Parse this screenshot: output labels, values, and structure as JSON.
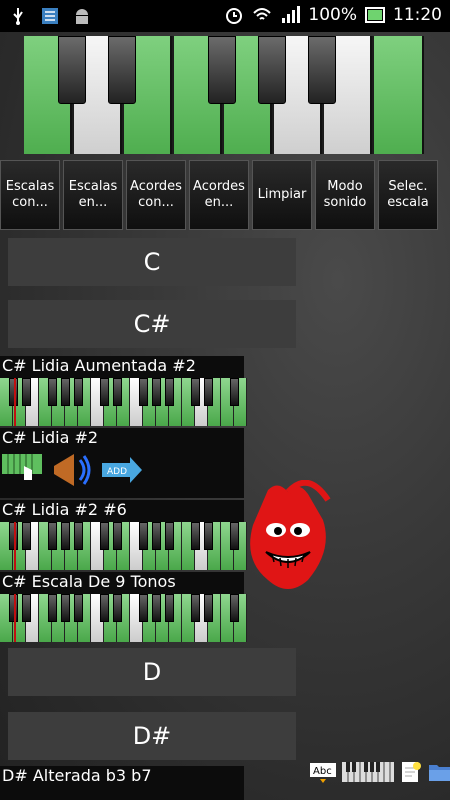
{
  "status": {
    "battery": "100%",
    "time": "11:20"
  },
  "buttons": [
    {
      "label": "Escalas con..."
    },
    {
      "label": "Escalas en..."
    },
    {
      "label": "Acordes con..."
    },
    {
      "label": "Acordes en..."
    },
    {
      "label": "Limpiar"
    },
    {
      "label": "Modo sonido"
    },
    {
      "label": "Selec. escala"
    }
  ],
  "notes": [
    "C",
    "C#",
    "D",
    "D#"
  ],
  "scales": [
    {
      "title": "C# Lidia Aumentada #2"
    },
    {
      "title": "C# Lidia #2"
    },
    {
      "title": "C# Lidia #2 #6"
    },
    {
      "title": "C# Escala De 9 Tonos"
    },
    {
      "title": "D# Alterada b3 b7"
    }
  ],
  "overlay": {
    "add_label": "ADD"
  },
  "tray": {
    "abc_label": "Abc"
  },
  "colors": {
    "green": "#5fbf5f",
    "background": "#2f2f2f"
  }
}
